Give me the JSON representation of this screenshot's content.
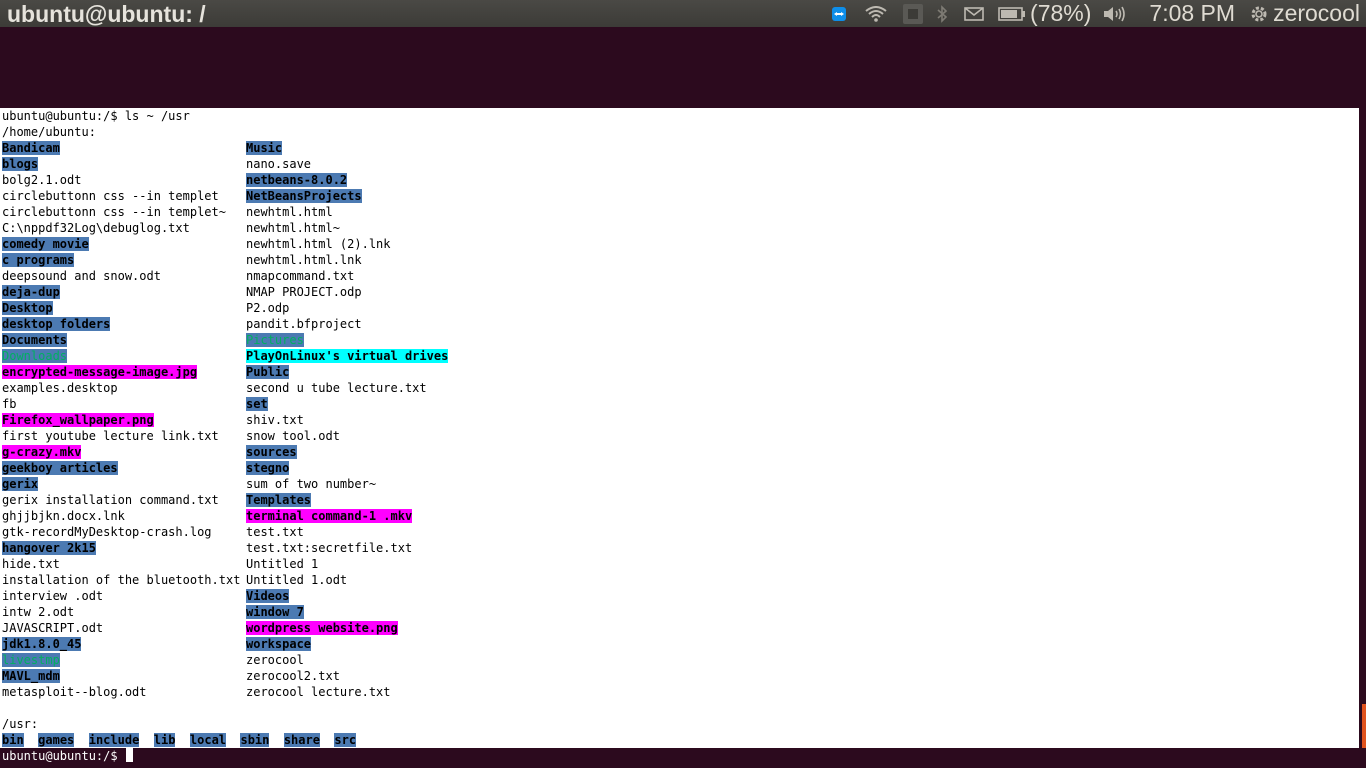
{
  "panel": {
    "title": "ubuntu@ubuntu: /",
    "battery": "(78%)",
    "clock": "7:08 PM",
    "user": "zerocool",
    "icons": [
      "teamviewer-icon",
      "wifi-icon",
      "keyboard-icon",
      "bluetooth-icon",
      "mail-icon",
      "battery-icon",
      "volume-icon",
      "gear-icon"
    ]
  },
  "terminal": {
    "command_line": "ubuntu@ubuntu:/$ ls ~ /usr",
    "home_header": "/home/ubuntu:",
    "col1": [
      {
        "t": "Bandicam",
        "k": "dir"
      },
      {
        "t": "blogs",
        "k": "dir"
      },
      {
        "t": "bolg2.1.odt",
        "k": "plain"
      },
      {
        "t": "circlebuttonn css --in templet",
        "k": "plain"
      },
      {
        "t": "circlebuttonn css --in templet~",
        "k": "plain"
      },
      {
        "t": "C:\\nppdf32Log\\debuglog.txt",
        "k": "plain"
      },
      {
        "t": "comedy movie",
        "k": "dir"
      },
      {
        "t": "c programs",
        "k": "dir"
      },
      {
        "t": "deepsound and snow.odt",
        "k": "plain"
      },
      {
        "t": "deja-dup",
        "k": "dir"
      },
      {
        "t": "Desktop",
        "k": "dir"
      },
      {
        "t": "desktop folders",
        "k": "dir"
      },
      {
        "t": "Documents",
        "k": "dir"
      },
      {
        "t": "Downloads",
        "k": "green"
      },
      {
        "t": "encrypted-message-image.jpg",
        "k": "img"
      },
      {
        "t": "examples.desktop",
        "k": "plain"
      },
      {
        "t": "fb",
        "k": "plain"
      },
      {
        "t": "Firefox_wallpaper.png",
        "k": "img"
      },
      {
        "t": "first youtube lecture link.txt",
        "k": "plain"
      },
      {
        "t": "g-crazy.mkv",
        "k": "img"
      },
      {
        "t": "geekboy articles",
        "k": "dir"
      },
      {
        "t": "gerix",
        "k": "dir"
      },
      {
        "t": "gerix installation command.txt",
        "k": "plain"
      },
      {
        "t": "ghjjbjkn.docx.lnk",
        "k": "plain"
      },
      {
        "t": "gtk-recordMyDesktop-crash.log",
        "k": "plain"
      },
      {
        "t": "hangover 2k15",
        "k": "dir"
      },
      {
        "t": "hide.txt",
        "k": "plain"
      },
      {
        "t": "installation of the bluetooth.txt",
        "k": "plain"
      },
      {
        "t": "interview .odt",
        "k": "plain"
      },
      {
        "t": "intw 2.odt",
        "k": "plain"
      },
      {
        "t": "JAVASCRIPT.odt",
        "k": "plain"
      },
      {
        "t": "jdk1.8.0_45",
        "k": "dir"
      },
      {
        "t": "livestmp",
        "k": "green"
      },
      {
        "t": "MAVL_mdm",
        "k": "dir"
      },
      {
        "t": "metasploit--blog.odt",
        "k": "plain"
      }
    ],
    "col2": [
      {
        "t": "Music",
        "k": "dir"
      },
      {
        "t": "nano.save",
        "k": "plain"
      },
      {
        "t": "netbeans-8.0.2",
        "k": "dir"
      },
      {
        "t": "NetBeansProjects",
        "k": "dir"
      },
      {
        "t": "newhtml.html",
        "k": "plain"
      },
      {
        "t": "newhtml.html~",
        "k": "plain"
      },
      {
        "t": "newhtml.html (2).lnk",
        "k": "plain"
      },
      {
        "t": "newhtml.html.lnk",
        "k": "plain"
      },
      {
        "t": "nmapcommand.txt",
        "k": "plain"
      },
      {
        "t": "NMAP PROJECT.odp",
        "k": "plain"
      },
      {
        "t": "P2.odp",
        "k": "plain"
      },
      {
        "t": "pandit.bfproject",
        "k": "plain"
      },
      {
        "t": "Pictures",
        "k": "green"
      },
      {
        "t": "PlayOnLinux's virtual drives",
        "k": "other"
      },
      {
        "t": "Public",
        "k": "dir"
      },
      {
        "t": "second u tube lecture.txt",
        "k": "plain"
      },
      {
        "t": "set",
        "k": "dir"
      },
      {
        "t": "shiv.txt",
        "k": "plain"
      },
      {
        "t": "snow tool.odt",
        "k": "plain"
      },
      {
        "t": "sources",
        "k": "dir"
      },
      {
        "t": "stegno",
        "k": "dir"
      },
      {
        "t": "sum of two number~",
        "k": "plain"
      },
      {
        "t": "Templates",
        "k": "dir"
      },
      {
        "t": "terminal command-1 .mkv",
        "k": "img"
      },
      {
        "t": "test.txt",
        "k": "plain"
      },
      {
        "t": "test.txt:secretfile.txt",
        "k": "plain"
      },
      {
        "t": "Untitled 1",
        "k": "plain"
      },
      {
        "t": "Untitled 1.odt",
        "k": "plain"
      },
      {
        "t": "Videos",
        "k": "dir"
      },
      {
        "t": "window 7",
        "k": "dir"
      },
      {
        "t": "wordpress website.png",
        "k": "img"
      },
      {
        "t": "workspace",
        "k": "dir"
      },
      {
        "t": "zerocool",
        "k": "plain"
      },
      {
        "t": "zerocool2.txt",
        "k": "plain"
      },
      {
        "t": "zerocool lecture.txt",
        "k": "plain"
      }
    ],
    "usr_header": "/usr:",
    "usr_dirs": [
      "bin",
      "games",
      "include",
      "lib",
      "local",
      "sbin",
      "share",
      "src"
    ],
    "prompt": "ubuntu@ubuntu:/$ "
  }
}
